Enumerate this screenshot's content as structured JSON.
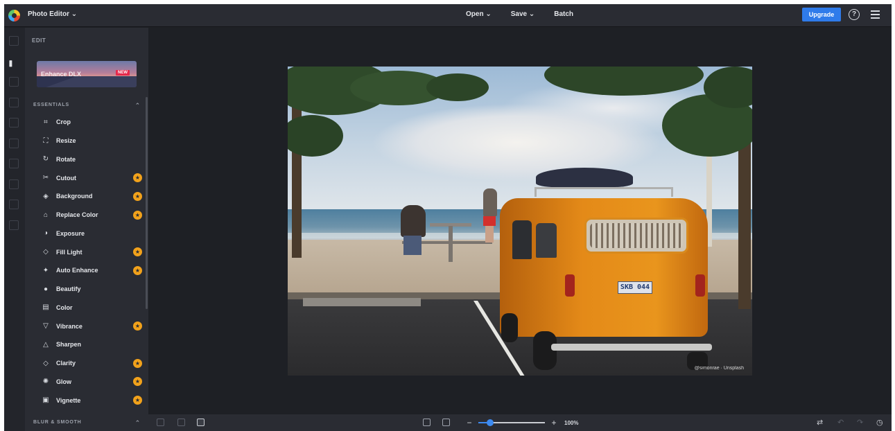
{
  "app": {
    "title": "Photo Editor ⌄",
    "nav": [
      "Open ⌄",
      "Save ⌄",
      "Batch"
    ],
    "upgrade_label": "Upgrade",
    "help_glyph": "?",
    "accent": "#2f7bea"
  },
  "rail": {
    "icons": [
      "image-icon",
      "adjust-sliders-icon",
      "eye-icon",
      "star-icon",
      "brush-icon",
      "frame-icon",
      "heart-icon",
      "shape-icon",
      "text-icon",
      "texture-icon"
    ],
    "active": "adjust-sliders-icon"
  },
  "panel": {
    "heading": "EDIT",
    "banner": {
      "label": "Enhance DLX",
      "badge": "NEW"
    },
    "sections": [
      {
        "title": "ESSENTIALS",
        "chevron": "⌃"
      },
      {
        "title": "BLUR & SMOOTH",
        "chevron": "⌃"
      }
    ],
    "tools": [
      {
        "label": "Crop",
        "icon": "crop-icon",
        "glyph": "⌗",
        "premium": false
      },
      {
        "label": "Resize",
        "icon": "resize-icon",
        "glyph": "⛶",
        "premium": false
      },
      {
        "label": "Rotate",
        "icon": "rotate-icon",
        "glyph": "↻",
        "premium": false
      },
      {
        "label": "Cutout",
        "icon": "cutout-icon",
        "glyph": "✂",
        "premium": true
      },
      {
        "label": "Background",
        "icon": "background-icon",
        "glyph": "◈",
        "premium": true
      },
      {
        "label": "Replace Color",
        "icon": "replace-color-icon",
        "glyph": "⌂",
        "premium": true
      },
      {
        "label": "Exposure",
        "icon": "exposure-icon",
        "glyph": "◑",
        "premium": false
      },
      {
        "label": "Fill Light",
        "icon": "fill-light-icon",
        "glyph": "◇",
        "premium": true
      },
      {
        "label": "Auto Enhance",
        "icon": "auto-enhance-icon",
        "glyph": "✦",
        "premium": true
      },
      {
        "label": "Beautify",
        "icon": "beautify-icon",
        "glyph": "●",
        "premium": false
      },
      {
        "label": "Color",
        "icon": "color-icon",
        "glyph": "▤",
        "premium": false
      },
      {
        "label": "Vibrance",
        "icon": "vibrance-icon",
        "glyph": "▽",
        "premium": true
      },
      {
        "label": "Sharpen",
        "icon": "sharpen-icon",
        "glyph": "△",
        "premium": false
      },
      {
        "label": "Clarity",
        "icon": "clarity-icon",
        "glyph": "◇",
        "premium": true
      },
      {
        "label": "Glow",
        "icon": "glow-icon",
        "glyph": "✺",
        "premium": true
      },
      {
        "label": "Vignette",
        "icon": "vignette-icon",
        "glyph": "▣",
        "premium": true
      }
    ],
    "premium_color": "#f2a21b",
    "premium_glyph": "★"
  },
  "canvas": {
    "photo_credit": "@simonrae · Unsplash",
    "license_plate": "SKB 044"
  },
  "bottombar": {
    "left_icons": [
      "layers-icon",
      "duplicate-icon",
      "compare-icon"
    ],
    "fit_icons": [
      "fit-screen-icon",
      "actual-size-icon"
    ],
    "zoom": {
      "minus": "−",
      "plus": "+",
      "value_label": "100%",
      "slider_fraction": 0.18
    },
    "right_icons": [
      {
        "name": "flip-icon",
        "glyph": "⇄"
      },
      {
        "name": "undo-icon",
        "glyph": "↶"
      },
      {
        "name": "redo-icon",
        "glyph": "↷"
      },
      {
        "name": "history-icon",
        "glyph": "◷"
      }
    ]
  }
}
